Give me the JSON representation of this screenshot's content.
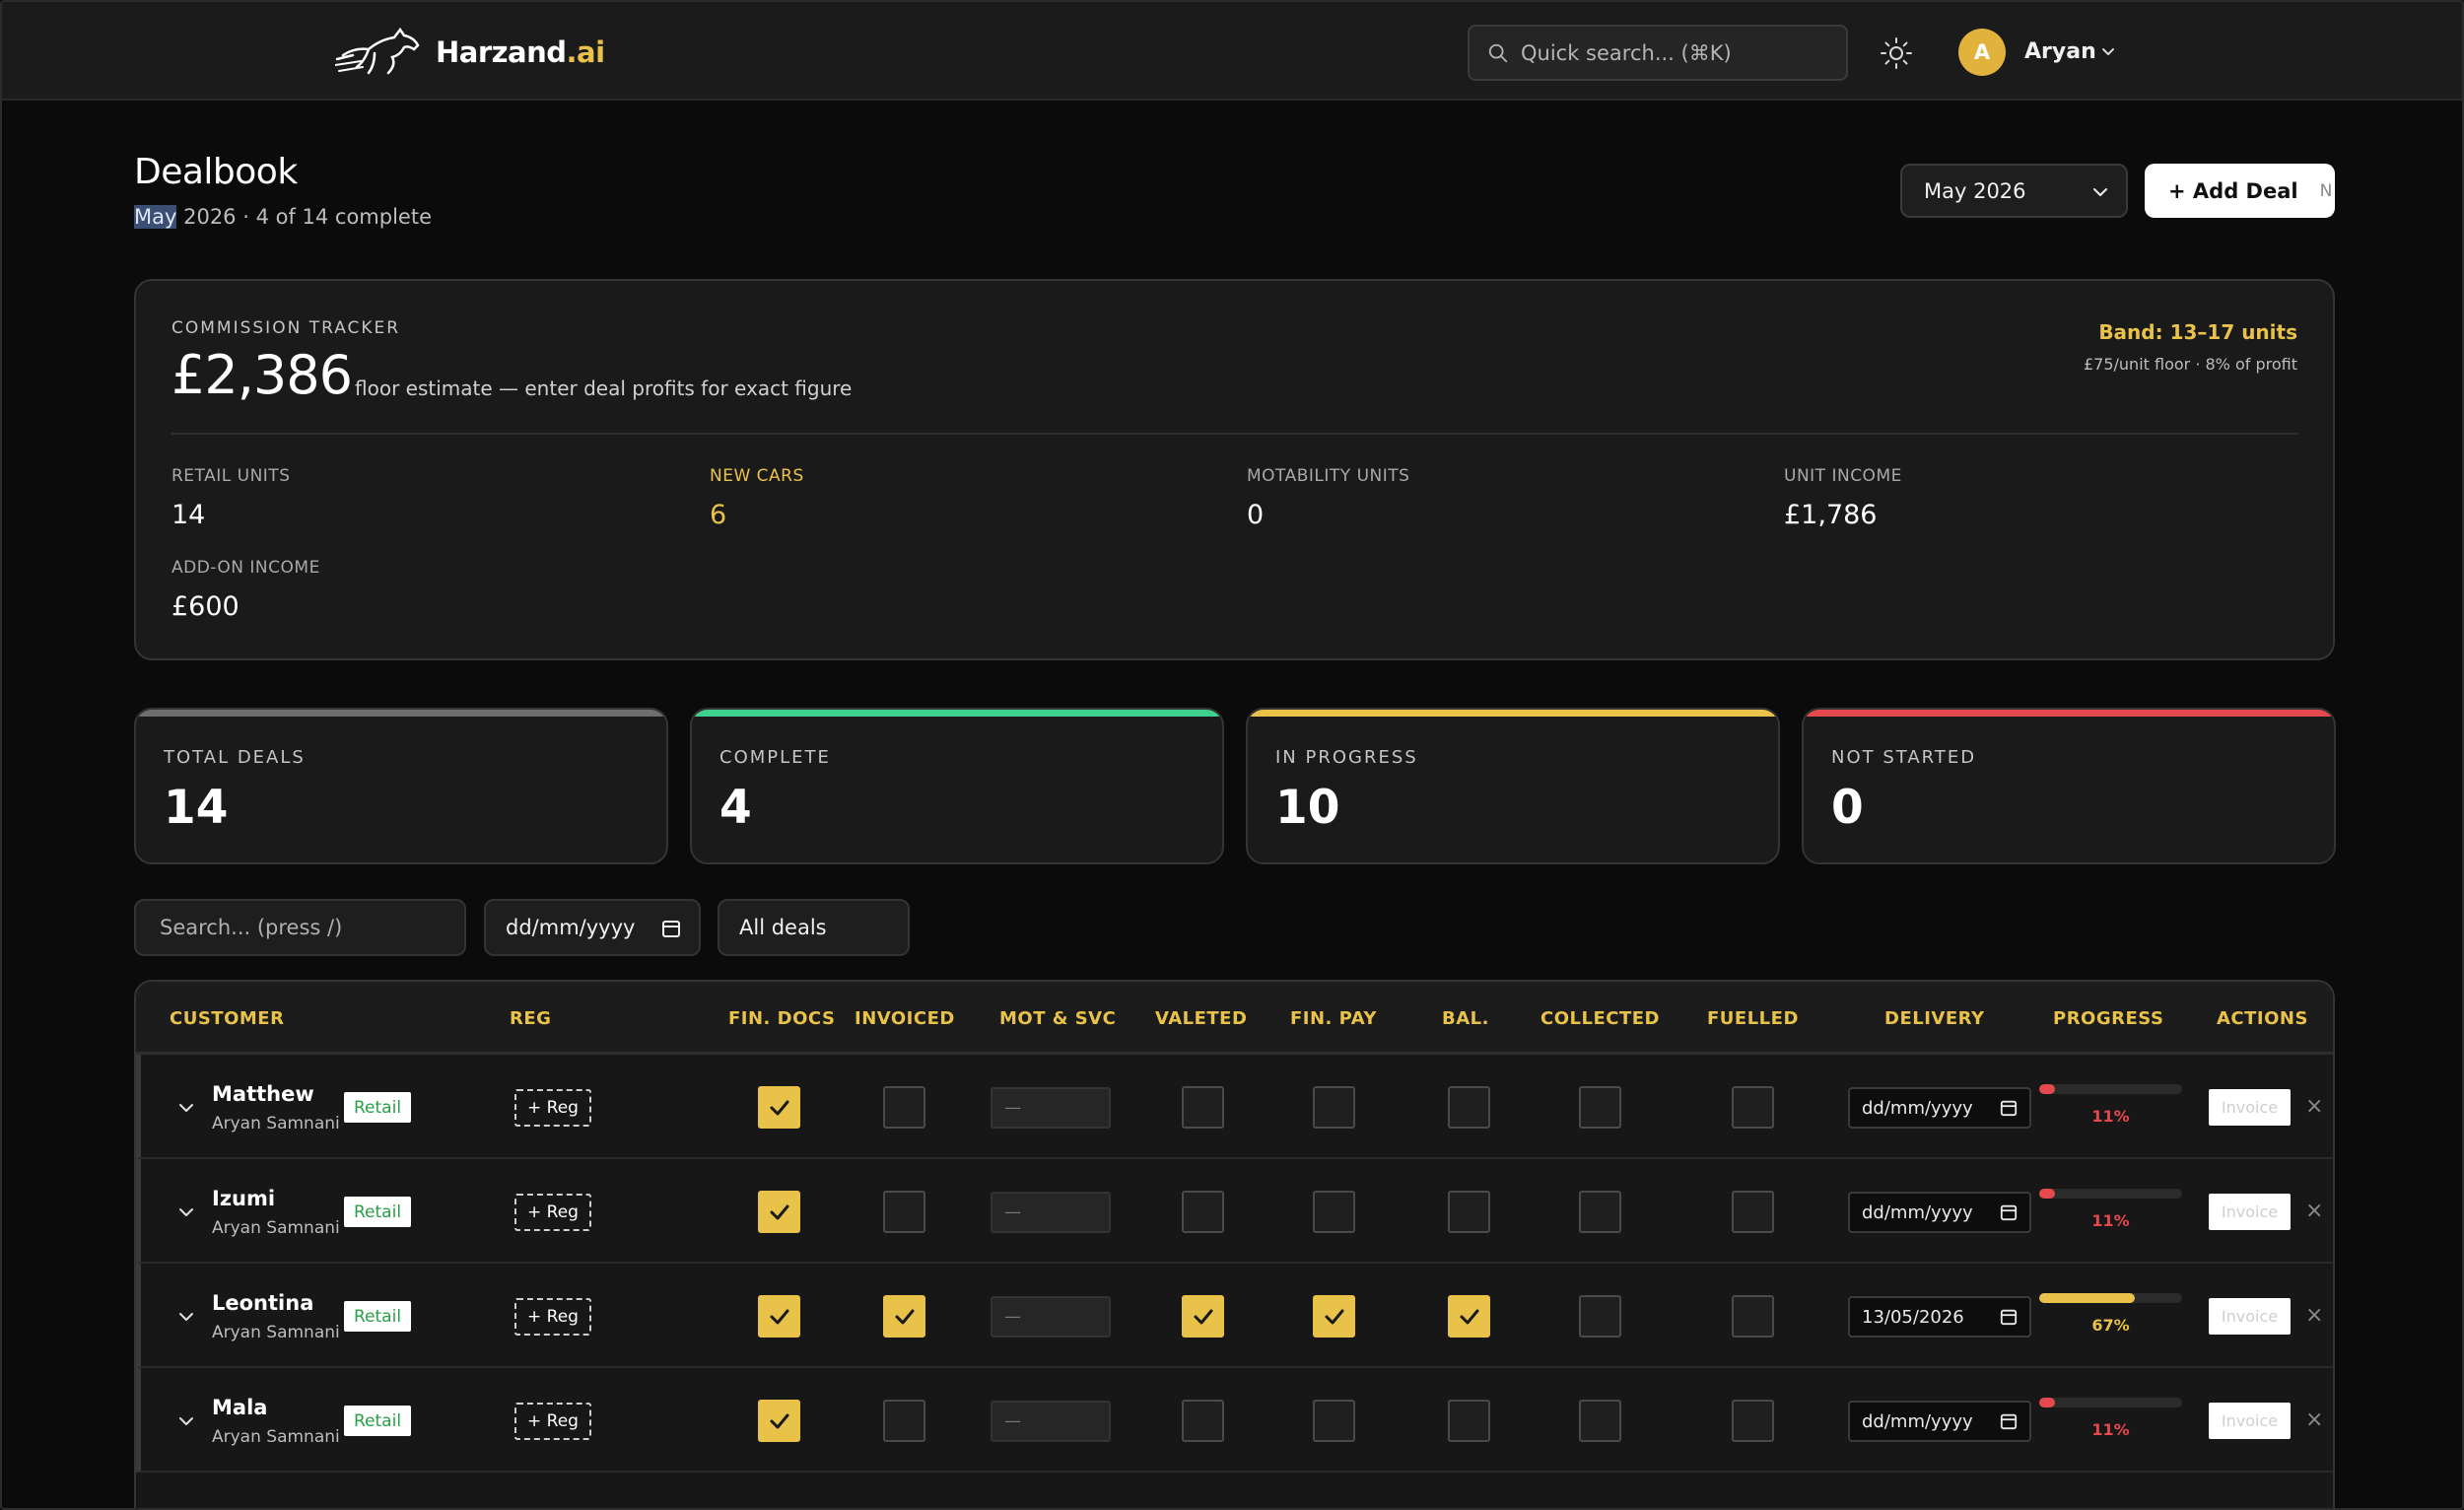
{
  "app": {
    "brand_main": "Harzand",
    "brand_suffix": ".ai"
  },
  "topbar": {
    "search_placeholder": "Quick search... (⌘K)",
    "user_initial": "A",
    "user_name": "Aryan"
  },
  "page": {
    "title": "Dealbook",
    "subtitle_highlight": "May",
    "subtitle_rest": " 2026 · 4 of 14 complete",
    "month_select": "May 2026",
    "add_deal_label": "+ Add Deal",
    "add_deal_shortcut": "N"
  },
  "tracker": {
    "label": "COMMISSION TRACKER",
    "amount": "£2,386",
    "note": "floor estimate — enter deal profits for exact figure",
    "band": "Band: 13–17 units",
    "band_sub": "£75/unit floor · 8% of profit",
    "stats": [
      {
        "label": "RETAIL UNITS",
        "value": "14"
      },
      {
        "label": "NEW CARS",
        "value": "6"
      },
      {
        "label": "MOTABILITY UNITS",
        "value": "0"
      },
      {
        "label": "UNIT INCOME",
        "value": "£1,786"
      },
      {
        "label": "ADD-ON INCOME",
        "value": "£600"
      }
    ]
  },
  "cards": [
    {
      "label": "TOTAL DEALS",
      "value": "14",
      "color": "#6e6e6e"
    },
    {
      "label": "COMPLETE",
      "value": "4",
      "color": "#3fcf8e"
    },
    {
      "label": "IN PROGRESS",
      "value": "10",
      "color": "#e9c24a"
    },
    {
      "label": "NOT STARTED",
      "value": "0",
      "color": "#e5484d"
    }
  ],
  "filters": {
    "search_placeholder": "Search... (press /)",
    "date_placeholder": "dd/mm/yyyy",
    "deal_filter": "All deals"
  },
  "table": {
    "columns": [
      "CUSTOMER",
      "REG",
      "FIN. DOCS",
      "INVOICED",
      "MOT & SVC",
      "VALETED",
      "FIN. PAY",
      "BAL.",
      "COLLECTED",
      "FUELLED",
      "DELIVERY",
      "PROGRESS",
      "ACTIONS"
    ],
    "rows": [
      {
        "name": "Matthew",
        "owner": "Aryan Samnani",
        "tag": "Retail",
        "reg": "+ Reg",
        "fin_docs": true,
        "invoiced": false,
        "mot": "—",
        "valeted": false,
        "fin_pay": false,
        "bal": false,
        "collected": false,
        "fuelled": false,
        "delivery": "dd/mm/yyyy",
        "progress": 0.11,
        "progress_label": "11%",
        "invoice": "Invoice"
      },
      {
        "name": "Izumi",
        "owner": "Aryan Samnani",
        "tag": "Retail",
        "reg": "+ Reg",
        "fin_docs": true,
        "invoiced": false,
        "mot": "—",
        "valeted": false,
        "fin_pay": false,
        "bal": false,
        "collected": false,
        "fuelled": false,
        "delivery": "dd/mm/yyyy",
        "progress": 0.11,
        "progress_label": "11%",
        "invoice": "Invoice"
      },
      {
        "name": "Leontina",
        "owner": "Aryan Samnani",
        "tag": "Retail",
        "reg": "+ Reg",
        "fin_docs": true,
        "invoiced": true,
        "mot": "—",
        "valeted": true,
        "fin_pay": true,
        "bal": true,
        "collected": false,
        "fuelled": false,
        "delivery": "13/05/2026",
        "progress": 0.67,
        "progress_label": "67%",
        "invoice": "Invoice"
      },
      {
        "name": "Mala",
        "owner": "Aryan Samnani",
        "tag": "Retail",
        "reg": "+ Reg",
        "fin_docs": true,
        "invoiced": false,
        "mot": "—",
        "valeted": false,
        "fin_pay": false,
        "bal": false,
        "collected": false,
        "fuelled": false,
        "delivery": "dd/mm/yyyy",
        "progress": 0.11,
        "progress_label": "11%",
        "invoice": "Invoice"
      }
    ]
  },
  "colors": {
    "accent": "#e9c24a",
    "progress_low": "#e5484d",
    "progress_mid": "#e9c24a",
    "tag_text": "#28a046"
  }
}
